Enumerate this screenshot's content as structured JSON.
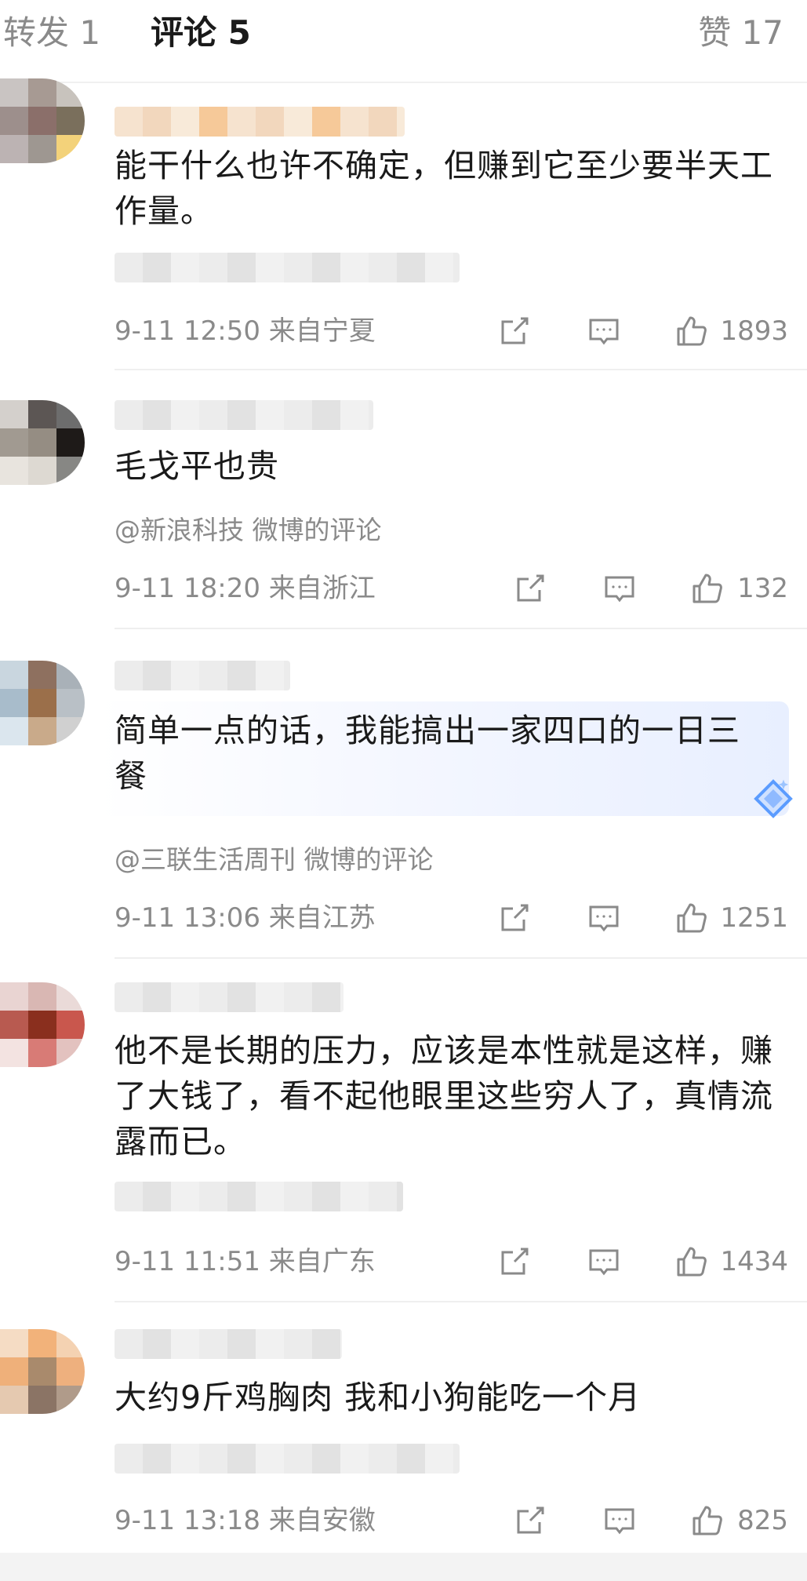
{
  "tabs": {
    "forward": "转发 1",
    "comments": "评论 5",
    "likes": "赞 17"
  },
  "icons": {
    "share": "share-icon",
    "reply": "comment-icon",
    "like": "thumbs-up-icon"
  },
  "colors": {
    "text_primary": "#1a1a1a",
    "text_secondary": "#8a8a8a",
    "divider": "#efefef",
    "bubble_accent": "#5b9cff"
  },
  "comments": [
    {
      "text": "能干什么也许不确定，但赚到它至少要半天工作量。",
      "source": "",
      "time": "9-11 12:50",
      "location": "来自宁夏",
      "likes": "1893"
    },
    {
      "text": "毛戈平也贵",
      "source": "@新浪科技 微博的评论",
      "time": "9-11 18:20",
      "location": "来自浙江",
      "likes": "132"
    },
    {
      "text": "简单一点的话，我能搞出一家四口的一日三餐",
      "source": "@三联生活周刊 微博的评论",
      "time": "9-11 13:06",
      "location": "来自江苏",
      "likes": "1251"
    },
    {
      "text": "他不是长期的压力，应该是本性就是这样，赚了大钱了，看不起他眼里这些穷人了，真情流露而已。",
      "source": "",
      "time": "9-11 11:51",
      "location": "来自广东",
      "likes": "1434"
    },
    {
      "text": "大约9斤鸡胸肉 我和小狗能吃一个月",
      "source": "",
      "time": "9-11 13:18",
      "location": "来自安徽",
      "likes": "825"
    }
  ]
}
